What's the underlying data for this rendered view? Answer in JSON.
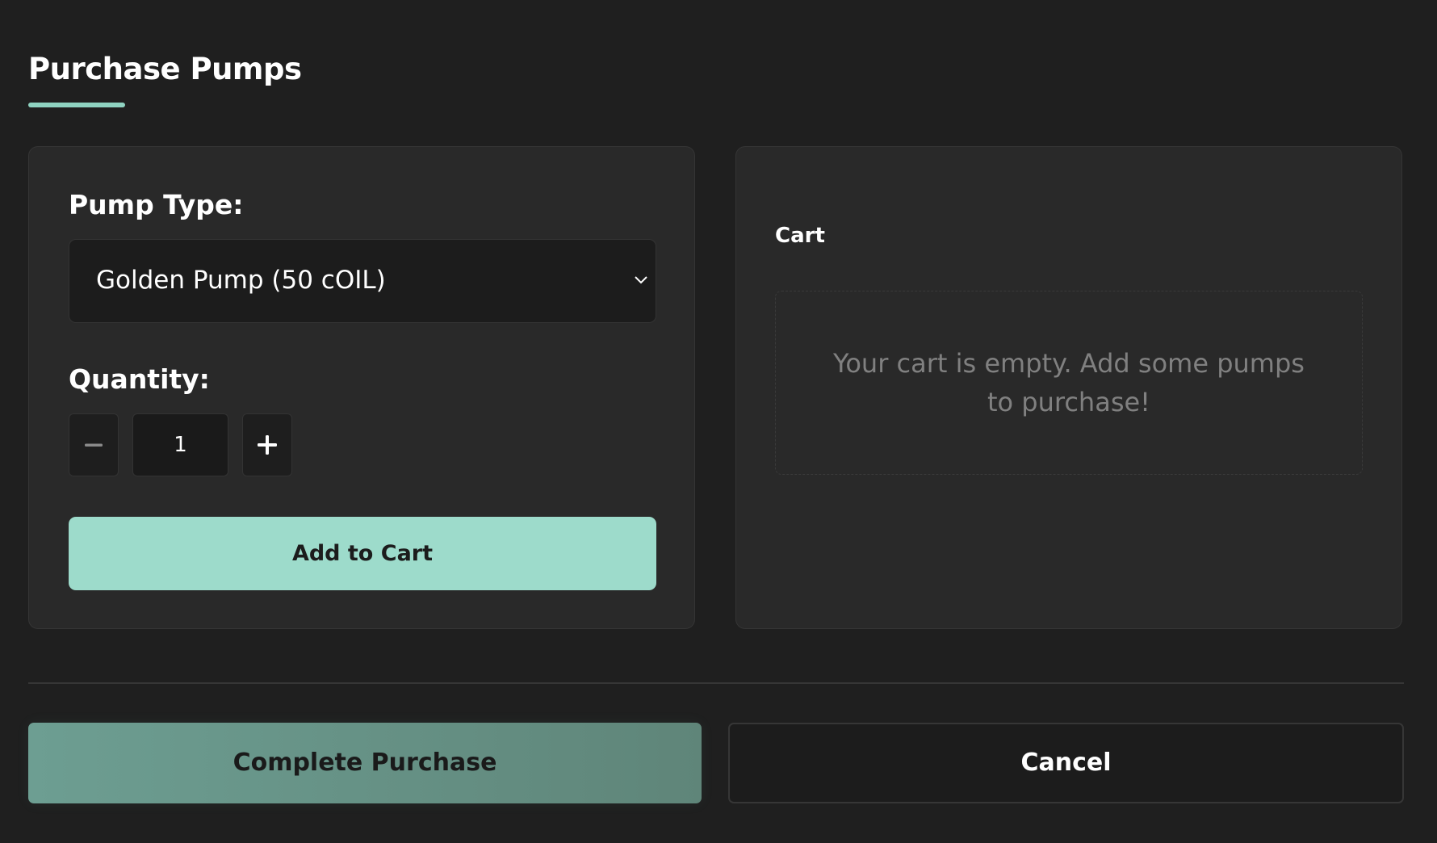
{
  "header": {
    "title": "Purchase Pumps",
    "accent_color": "#8fd3c1"
  },
  "form": {
    "pump_type_label": "Pump Type:",
    "pump_type_selected": "Golden Pump (50 cOIL)",
    "quantity_label": "Quantity:",
    "quantity_value": "1",
    "decrement_icon": "minus-icon",
    "increment_icon": "plus-icon",
    "add_to_cart_label": "Add to Cart",
    "add_button_color": "#9ddbcb"
  },
  "cart": {
    "title": "Cart",
    "empty_message": "Your cart is empty. Add some pumps to purchase!"
  },
  "footer": {
    "complete_label": "Complete Purchase",
    "cancel_label": "Cancel",
    "complete_button_color": "#6d9e92"
  }
}
